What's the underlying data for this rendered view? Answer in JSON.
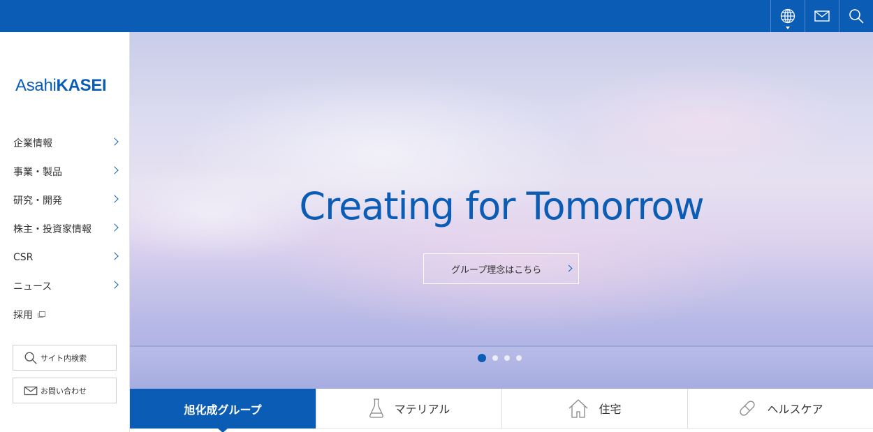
{
  "header": {
    "icons": [
      {
        "name": "globe-icon"
      },
      {
        "name": "mail-icon"
      },
      {
        "name": "search-icon"
      }
    ]
  },
  "logo": {
    "part1": "Asahi",
    "part2": "KASEI"
  },
  "sidebar": {
    "items": [
      {
        "label": "企業情報",
        "chevron": true
      },
      {
        "label": "事業・製品",
        "chevron": true
      },
      {
        "label": "研究・開発",
        "chevron": true
      },
      {
        "label": "株主・投資家情報",
        "chevron": true
      },
      {
        "label": "CSR",
        "chevron": true
      },
      {
        "label": "ニュース",
        "chevron": true
      },
      {
        "label": "採用",
        "external": true
      }
    ],
    "search_button": "サイト内検索",
    "contact_button": "お問い合わせ"
  },
  "hero": {
    "title": "Creating for Tomorrow",
    "button_label": "グループ理念はこちら",
    "slides_total": 4,
    "active_slide": 1
  },
  "tabs": [
    {
      "label": "旭化成グループ",
      "active": true,
      "icon": ""
    },
    {
      "label": "マテリアル",
      "active": false,
      "icon": "flask-icon"
    },
    {
      "label": "住宅",
      "active": false,
      "icon": "house-icon"
    },
    {
      "label": "ヘルスケア",
      "active": false,
      "icon": "capsule-icon"
    }
  ],
  "colors": {
    "brand": "#0a5cb4"
  }
}
